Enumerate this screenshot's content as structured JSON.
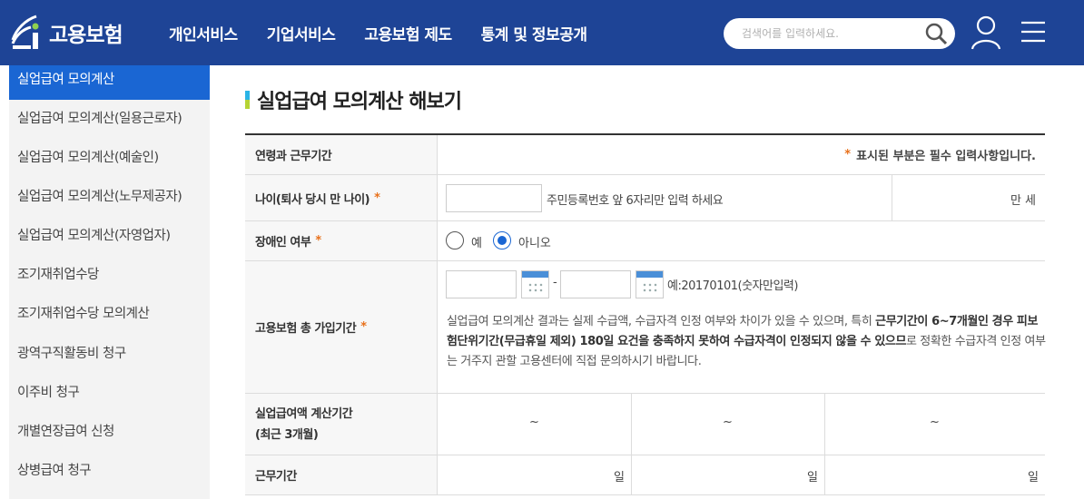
{
  "header": {
    "logo_text": "고용보험",
    "nav": [
      "개인서비스",
      "기업서비스",
      "고용보험 제도",
      "통계 및 정보공개"
    ],
    "search_placeholder": "검색어를 입력하세요.",
    "bg_color": "#1e4496"
  },
  "sidebar": {
    "active_color": "#1a66d3",
    "items": [
      {
        "label": "실업급여 모의계산",
        "active": true
      },
      {
        "label": "실업급여 모의계산(일용근로자)"
      },
      {
        "label": "실업급여 모의계산(예술인)"
      },
      {
        "label": "실업급여 모의계산(노무제공자)"
      },
      {
        "label": "실업급여 모의계산(자영업자)"
      },
      {
        "label": "조기재취업수당"
      },
      {
        "label": "조기재취업수당 모의계산"
      },
      {
        "label": "광역구직활동비 청구"
      },
      {
        "label": "이주비 청구"
      },
      {
        "label": "개별연장급여 신청"
      },
      {
        "label": "상병급여 청구"
      }
    ]
  },
  "main": {
    "title": "실업급여 모의계산 해보기",
    "rows": {
      "header_label": "연령과 근무기간",
      "required_mark": "*",
      "required_note": "표시된 부분은 필수 입력사항입니다.",
      "age_label": "나이(퇴사 당시 만 나이)",
      "age_hint": "주민등록번호 앞 6자리만 입력 하세요",
      "age_unit": "만 세",
      "disability_label": "장애인 여부",
      "radio_yes": "예",
      "radio_no": "아니오",
      "period_label": "고용보험 총 가입기간",
      "date_sep": "-",
      "date_hint": "예:20170101(숫자만입력)",
      "notice_1": "실업급여 모의계산 결과는 실제 수급액, 수급자격 인정 여부와 차이가 있을 수 있으며, 특히 ",
      "notice_bold_1": "근무기간이 6~7개월인 경우 피보험단위기간(무급휴일 제외) 180일 요건을 충족하지 못하여 수급자격이 인정되지 않을 수 있으므",
      "notice_2": "로 정확한 수급자격 인정 여부는 거주지 관할 고용센터에 직접 문의하시기 바랍니다.",
      "calc_label_1": "실업급여액 계산기간",
      "calc_label_2": "(최근 3개월)",
      "tilde": "~",
      "work_label": "근무기간",
      "day_unit": "일"
    }
  }
}
